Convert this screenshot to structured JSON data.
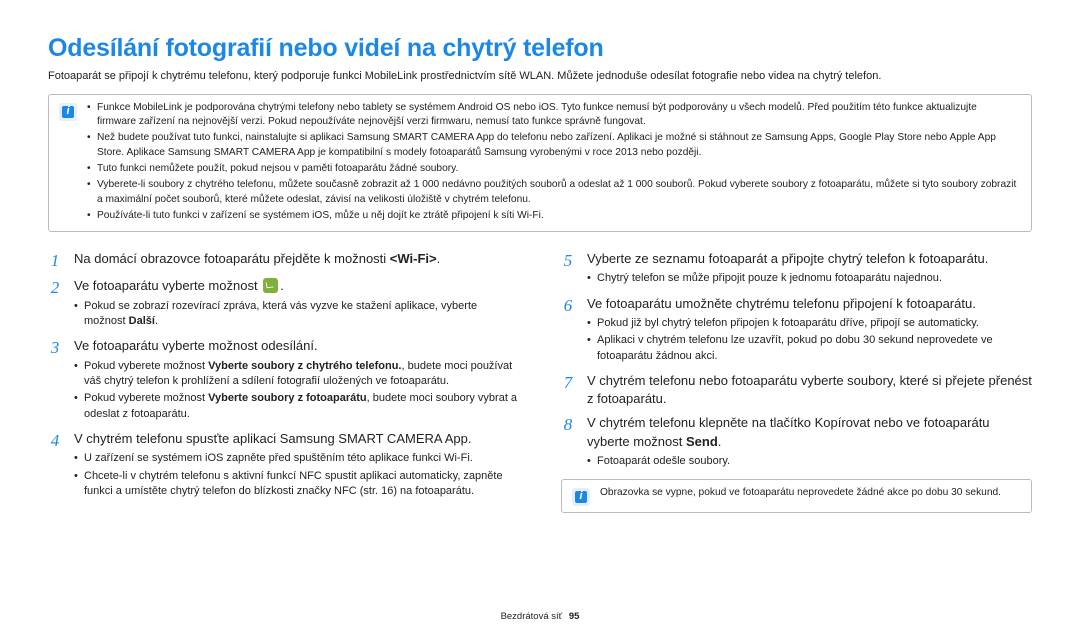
{
  "title": "Odesílání fotografií nebo videí na chytrý telefon",
  "intro": "Fotoaparát se připojí k chytrému telefonu, který podporuje funkci MobileLink prostřednictvím sítě WLAN. Můžete jednoduše odesílat fotografie nebo videa na chytrý telefon.",
  "top_notes": [
    "Funkce MobileLink je podporována chytrými telefony nebo tablety se systémem Android OS nebo iOS. Tyto funkce nemusí být podporovány u všech modelů. Před použitím této funkce aktualizujte firmware zařízení na nejnovější verzi. Pokud nepoužíváte nejnovější verzi firmwaru, nemusí tato funkce správně fungovat.",
    "Než budete používat tuto funkci, nainstalujte si aplikaci Samsung SMART CAMERA App do telefonu nebo zařízení. Aplikaci je možné si stáhnout ze Samsung Apps, Google Play Store nebo Apple App Store. Aplikace Samsung SMART CAMERA App je kompatibilní s modely fotoaparátů Samsung vyrobenými v roce 2013 nebo později.",
    "Tuto funkci nemůžete použít, pokud nejsou v paměti fotoaparátu žádné soubory.",
    "Vyberete-li soubory z chytrého telefonu, můžete současně zobrazit až 1 000 nedávno použitých souborů a odeslat až 1 000 souborů. Pokud vyberete soubory z fotoaparátu, můžete si tyto soubory zobrazit a maximální počet souborů, které můžete odeslat, závisí na velikosti úložiště v chytrém telefonu.",
    "Používáte-li tuto funkci v zařízení se systémem iOS, může u něj dojít ke ztrátě připojení k síti Wi-Fi."
  ],
  "left_steps": [
    {
      "n": "1",
      "html": "Na domácí obrazovce fotoaparátu přejděte k možnosti <b>&lt;Wi-Fi&gt;</b>.",
      "bullets": []
    },
    {
      "n": "2",
      "html": "Ve fotoaparátu vyberte možnost <span class=\"inline-icon\" data-name=\"mobilelink-icon\" data-interactable=\"false\"></span>.",
      "bullets": [
        "Pokud se zobrazí rozevírací zpráva, která vás vyzve ke stažení aplikace, vyberte možnost <b>Další</b>."
      ]
    },
    {
      "n": "3",
      "html": "Ve fotoaparátu vyberte možnost odesílání.",
      "bullets": [
        "Pokud vyberete možnost <b>Vyberte soubory z chytrého telefonu.</b>, budete moci používat váš chytrý telefon k prohlížení a sdílení fotografií uložených ve fotoaparátu.",
        "Pokud vyberete možnost <b>Vyberte soubory z fotoaparátu</b>, budete moci soubory vybrat a odeslat z fotoaparátu."
      ]
    },
    {
      "n": "4",
      "html": "V chytrém telefonu spusťte aplikaci Samsung SMART CAMERA App.",
      "bullets": [
        "U zařízení se systémem iOS zapněte před spuštěním této aplikace funkci Wi-Fi.",
        "Chcete-li v chytrém telefonu s aktivní funkcí NFC spustit aplikaci automaticky, zapněte funkci a umístěte chytrý telefon do blízkosti značky NFC (str. 16) na fotoaparátu."
      ]
    }
  ],
  "right_steps": [
    {
      "n": "5",
      "html": "Vyberte ze seznamu fotoaparát a připojte chytrý telefon k fotoaparátu.",
      "bullets": [
        "Chytrý telefon se může připojit pouze k jednomu fotoaparátu najednou."
      ]
    },
    {
      "n": "6",
      "html": "Ve fotoaparátu umožněte chytrému telefonu připojení k fotoaparátu.",
      "bullets": [
        "Pokud již byl chytrý telefon připojen k fotoaparátu dříve, připojí se automaticky.",
        "Aplikaci v chytrém telefonu lze uzavřít, pokud po dobu 30 sekund neprovedete ve fotoaparátu žádnou akci."
      ]
    },
    {
      "n": "7",
      "html": "V chytrém telefonu nebo fotoaparátu vyberte soubory, které si přejete přenést z fotoaparátu.",
      "bullets": []
    },
    {
      "n": "8",
      "html": "V chytrém telefonu klepněte na tlačítko Kopírovat nebo ve fotoaparátu vyberte možnost <b>Send</b>.",
      "bullets": [
        "Fotoaparát odešle soubory."
      ]
    }
  ],
  "bottom_note": "Obrazovka se vypne, pokud ve fotoaparátu neprovedete žádné akce po dobu 30 sekund.",
  "footer_section": "Bezdrátová síť",
  "footer_page": "95"
}
